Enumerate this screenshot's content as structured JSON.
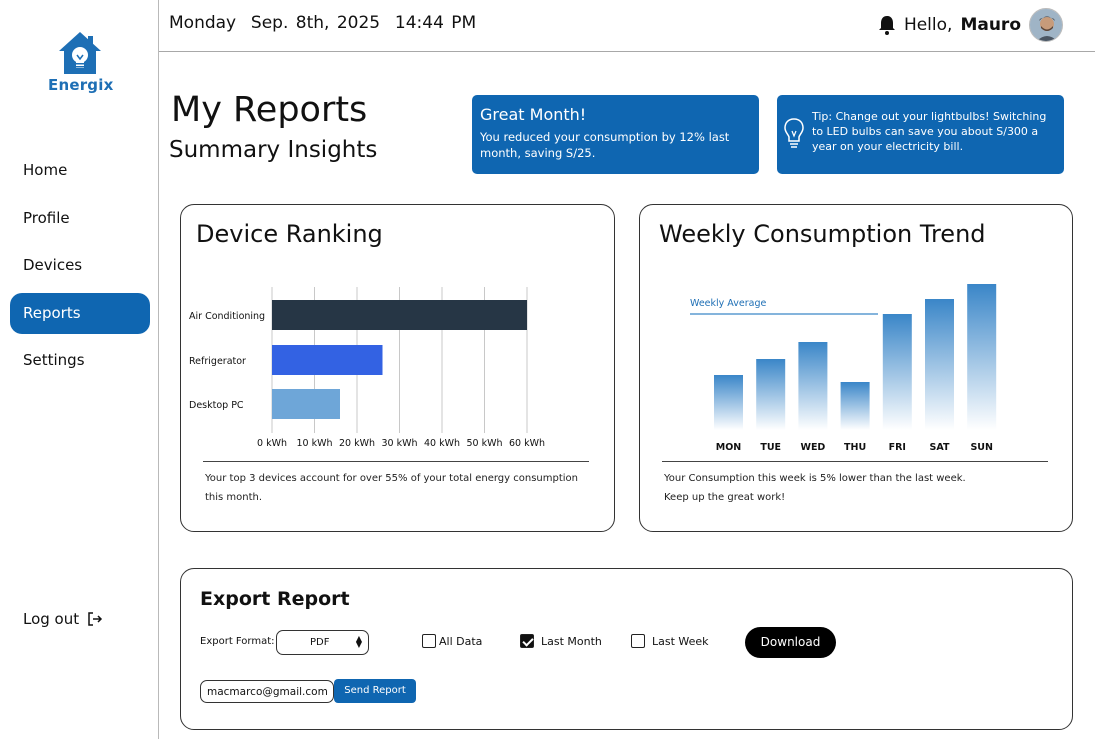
{
  "app": {
    "name": "Energix"
  },
  "sidebar": {
    "items": [
      {
        "label": "Home"
      },
      {
        "label": "Profile"
      },
      {
        "label": "Devices"
      },
      {
        "label": "Reports",
        "active": true
      },
      {
        "label": "Settings"
      }
    ],
    "logout_label": "Log out"
  },
  "header": {
    "datetime": "Monday  Sep. 8th, 2025  14:44 PM",
    "greeting_prefix": "Hello,",
    "user_name": "Mauro"
  },
  "page": {
    "title": "My Reports",
    "subtitle": "Summary Insights"
  },
  "banners": {
    "great_month_title": "Great Month!",
    "great_month_text": "You reduced your consumption by 12% last month, saving S/25.",
    "tip_text": "Tip: Change out your lightbulbs! Switching to LED bulbs can save you about S/300 a year on your electricity bill."
  },
  "device_ranking": {
    "title": "Device Ranking",
    "note": "Your top 3 devices account for over 55% of your total energy consumption this month."
  },
  "weekly_trend": {
    "title": "Weekly Consumption Trend",
    "note_line1": "Your Consumption this week is 5% lower than the last week.",
    "note_line2": "Keep up the great work!"
  },
  "chart_data": [
    {
      "type": "bar",
      "orientation": "horizontal",
      "categories": [
        "Air Conditioning",
        "Refrigerator",
        "Desktop PC"
      ],
      "values": [
        60,
        26,
        16
      ],
      "colors": [
        "#263645",
        "#3362e3",
        "#6ea6d8"
      ],
      "xticks": [
        "0 kWh",
        "10 kWh",
        "20 kWh",
        "30 kWh",
        "40 kWh",
        "50 kWh",
        "60 kWh"
      ],
      "xlim": [
        0,
        60
      ],
      "grid": true
    },
    {
      "type": "bar",
      "categories": [
        "MON",
        "TUE",
        "WED",
        "THU",
        "FRI",
        "SAT",
        "SUN"
      ],
      "values": [
        55,
        71,
        88,
        48,
        116,
        131,
        146
      ],
      "ylim": [
        0,
        146
      ],
      "reference_line": {
        "label": "Weekly Average",
        "value": 116
      },
      "color": "#3a86c8"
    }
  ],
  "export": {
    "title": "Export Report",
    "format_label": "Export Format:",
    "format_value": "PDF",
    "options": [
      {
        "label": "All Data",
        "checked": false
      },
      {
        "label": "Last Month",
        "checked": true
      },
      {
        "label": "Last Week",
        "checked": false
      }
    ],
    "download_label": "Download",
    "email_value": "macmarco@gmail.com",
    "send_label": "Send Report"
  },
  "colors": {
    "primary": "#0f66b1",
    "dark": "#000000"
  }
}
